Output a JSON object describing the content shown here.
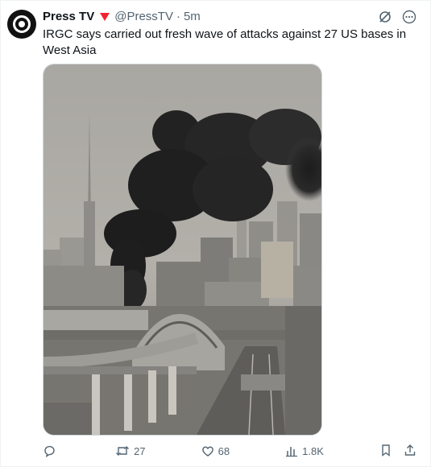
{
  "tweet": {
    "author_name": "Press TV",
    "handle": "@PressTV",
    "separator": "·",
    "time": "5m",
    "text": "IRGC says carried out fresh wave of attacks against 27 US bases in West Asia"
  },
  "media": {
    "description_icon": "photo-of-city-skyline-with-black-smoke"
  },
  "actions": {
    "reply_count": "",
    "retweet_count": "27",
    "like_count": "68",
    "view_count": "1.8K"
  },
  "colors": {
    "text_primary": "#0f1419",
    "text_secondary": "#536471",
    "badge": "#f4212e",
    "border": "#cfd9de"
  }
}
